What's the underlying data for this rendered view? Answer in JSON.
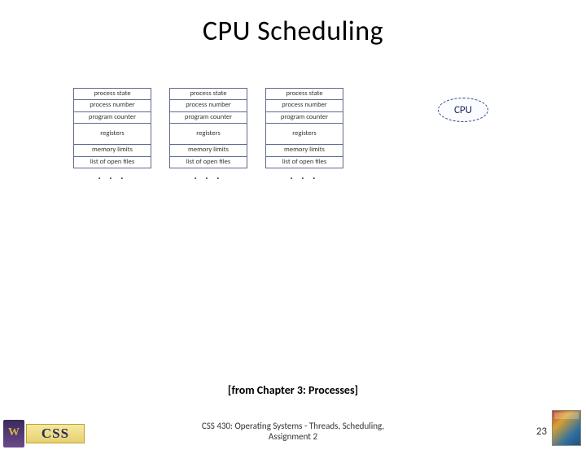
{
  "title": "CPU Scheduling",
  "pcb_rows": {
    "r0": "process state",
    "r1": "process number",
    "r2": "program counter",
    "r3": "registers",
    "r4": "memory limits",
    "r5": "list of open files"
  },
  "ellipsis": ". . .",
  "cpu_label": "CPU",
  "caption": "[from Chapter 3: Processes]",
  "footer_line1": "CSS 430: Operating Systems - Threads, Scheduling,",
  "footer_line2": "Assignment 2",
  "page_number": "23",
  "css_logo_text": "CSS"
}
